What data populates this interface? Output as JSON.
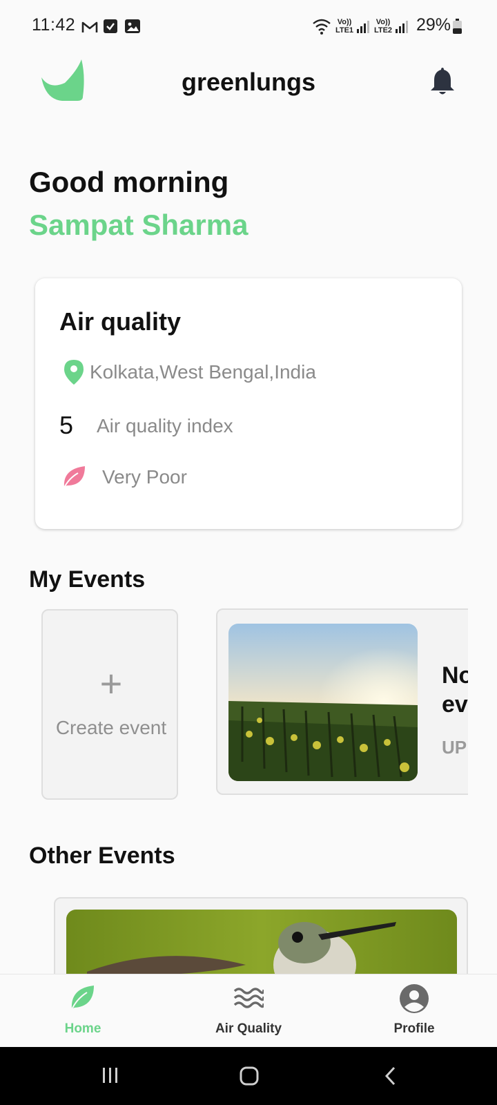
{
  "status_bar": {
    "time": "11:42",
    "network_labels": [
      "Vo)) LTE1",
      "Vo)) LTE2"
    ],
    "battery": "29%"
  },
  "header": {
    "title": "greenlungs",
    "brand_color": "#6bd48a"
  },
  "greeting": {
    "salutation": "Good morning",
    "user_name": "Sampat Sharma"
  },
  "air_quality": {
    "title": "Air quality",
    "location": "Kolkata,West Bengal,India",
    "index_value": "5",
    "index_label": "Air quality index",
    "status": "Very Poor",
    "status_color": "#f07a9a"
  },
  "my_events": {
    "title": "My Events",
    "create_label": "Create event",
    "event": {
      "title_line1": "No",
      "title_line2": "ev",
      "subtitle": "UP"
    }
  },
  "other_events": {
    "title": "Other Events"
  },
  "bottom_nav": {
    "items": [
      {
        "label": "Home",
        "icon": "leaf-icon",
        "active": true
      },
      {
        "label": "Air Quality",
        "icon": "waves-icon",
        "active": false
      },
      {
        "label": "Profile",
        "icon": "profile-icon",
        "active": false
      }
    ],
    "active_color": "#6bd48a",
    "inactive_color": "#333333"
  }
}
